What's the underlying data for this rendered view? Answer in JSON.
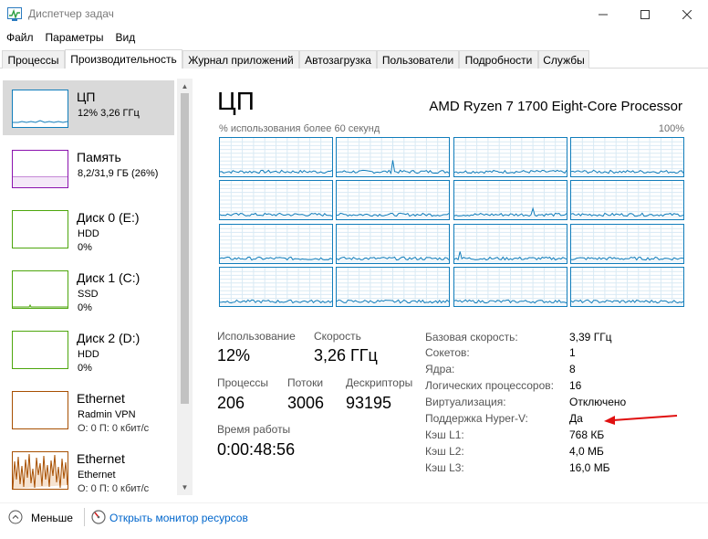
{
  "window": {
    "title": "Диспетчер задач",
    "icon": "task-manager-icon"
  },
  "menu": [
    "Файл",
    "Параметры",
    "Вид"
  ],
  "tabs": [
    "Процессы",
    "Производительность",
    "Журнал приложений",
    "Автозагрузка",
    "Пользователи",
    "Подробности",
    "Службы"
  ],
  "active_tab": "Производительность",
  "resources": [
    {
      "title": "ЦП",
      "line1": "12% 3,26 ГГц",
      "line2": "",
      "color": "#117dbb"
    },
    {
      "title": "Память",
      "line1": "8,2/31,9 ГБ (26%)",
      "line2": "",
      "color": "#8b12ae"
    },
    {
      "title": "Диск 0 (E:)",
      "line1": "HDD",
      "line2": "0%",
      "color": "#4da60c"
    },
    {
      "title": "Диск 1 (C:)",
      "line1": "SSD",
      "line2": "0%",
      "color": "#4da60c"
    },
    {
      "title": "Диск 2 (D:)",
      "line1": "HDD",
      "line2": "0%",
      "color": "#4da60c"
    },
    {
      "title": "Ethernet",
      "line1": "Radmin VPN",
      "line2": "О: 0 П: 0 кбит/с",
      "color": "#a74f01"
    },
    {
      "title": "Ethernet",
      "line1": "Ethernet",
      "line2": "О: 0 П: 0 кбит/с",
      "color": "#a74f01"
    }
  ],
  "cpu": {
    "heading": "ЦП",
    "model": "AMD Ryzen 7 1700 Eight-Core Processor",
    "graph_label": "% использования более 60 секунд",
    "graph_max": "100%",
    "stats": {
      "usage_label": "Использование",
      "usage": "12%",
      "speed_label": "Скорость",
      "speed": "3,26 ГГц",
      "processes_label": "Процессы",
      "processes": "206",
      "threads_label": "Потоки",
      "threads": "3006",
      "handles_label": "Дескрипторы",
      "handles": "93195",
      "uptime_label": "Время работы",
      "uptime": "0:00:48:56"
    },
    "info": [
      {
        "label": "Базовая скорость:",
        "value": "3,39 ГГц"
      },
      {
        "label": "Сокетов:",
        "value": "1"
      },
      {
        "label": "Ядра:",
        "value": "8"
      },
      {
        "label": "Логических процессоров:",
        "value": "16"
      },
      {
        "label": "Виртуализация:",
        "value": "Отключено"
      },
      {
        "label": "Поддержка Hyper-V:",
        "value": "Да"
      },
      {
        "label": "Кэш L1:",
        "value": "768 КБ"
      },
      {
        "label": "Кэш L2:",
        "value": "4,0 МБ"
      },
      {
        "label": "Кэш L3:",
        "value": "16,0 МБ"
      }
    ]
  },
  "footer": {
    "less_label": "Меньше",
    "resource_monitor_link": "Открыть монитор ресурсов"
  },
  "colors": {
    "cpu_line": "#117dbb",
    "annotation_arrow": "#e01010"
  }
}
